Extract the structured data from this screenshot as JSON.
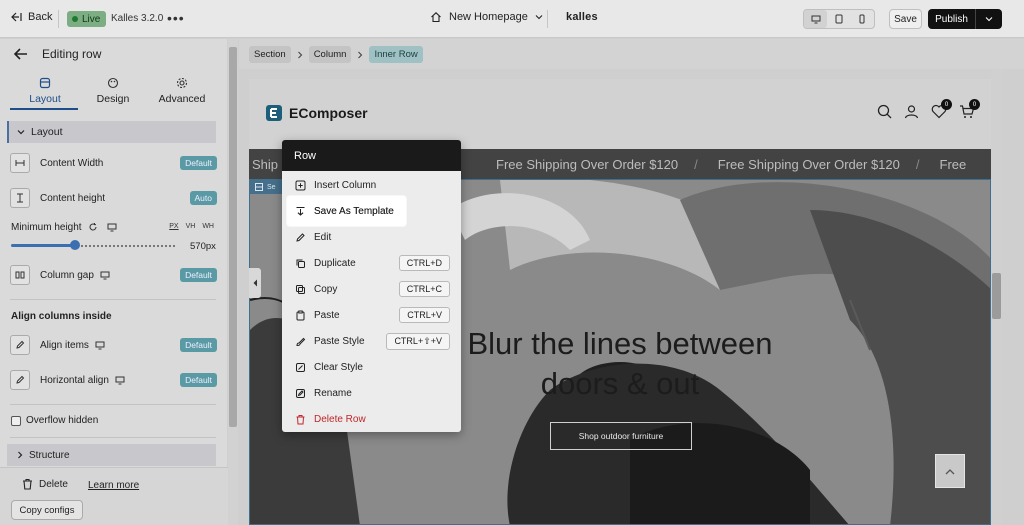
{
  "topbar": {
    "back_label": "Back",
    "live_label": "Live",
    "version": "Kalles 3.2.0",
    "page_name": "New Homepage",
    "brand": "kalles",
    "save_label": "Save",
    "publish_label": "Publish"
  },
  "panel": {
    "title": "Editing row",
    "tabs": [
      {
        "label": "Layout"
      },
      {
        "label": "Design"
      },
      {
        "label": "Advanced"
      }
    ],
    "layout_section": "Layout",
    "content_width": {
      "label": "Content Width",
      "badge": "Default"
    },
    "content_height": {
      "label": "Content height",
      "badge": "Auto"
    },
    "min_height": {
      "label": "Minimum height",
      "units": [
        "PX",
        "VH",
        "WH"
      ],
      "value": "570px",
      "slider_fraction": 0.39
    },
    "column_gap": {
      "label": "Column gap",
      "badge": "Default"
    },
    "align_heading": "Align columns inside",
    "align_items": {
      "label": "Align items",
      "badge": "Default"
    },
    "horizontal_align": {
      "label": "Horizontal align",
      "badge": "Default"
    },
    "overflow_label": "Overflow hidden",
    "structure_section": "Structure",
    "delete_label": "Delete",
    "learn_more": "Learn more",
    "copy_configs": "Copy configs"
  },
  "breadcrumb": [
    "Section",
    "Column",
    "Inner Row"
  ],
  "site": {
    "logo": "EComposer",
    "counts": {
      "wishlist": "0",
      "cart": "0"
    },
    "marquee_first": "Ship",
    "marquee_items": [
      "Free Shipping Over Order $120",
      "Free Shipping Over Order $120",
      "Free"
    ],
    "marquee_sep": "/",
    "hero_line1": "Blur the lines between",
    "hero_line2": "doors & out",
    "hero_button": "Shop outdoor furniture",
    "selection_label": "Se"
  },
  "context_menu": {
    "title": "Row",
    "items": [
      {
        "label": "Insert Column",
        "shortcut": ""
      },
      {
        "label": "Save As Template",
        "shortcut": ""
      },
      {
        "label": "Edit",
        "shortcut": ""
      },
      {
        "label": "Duplicate",
        "shortcut": "CTRL+D"
      },
      {
        "label": "Copy",
        "shortcut": "CTRL+C"
      },
      {
        "label": "Paste",
        "shortcut": "CTRL+V"
      },
      {
        "label": "Paste Style",
        "shortcut": "CTRL+⇧+V"
      },
      {
        "label": "Clear Style",
        "shortcut": ""
      },
      {
        "label": "Rename",
        "shortcut": ""
      },
      {
        "label": "Delete Row",
        "shortcut": ""
      }
    ]
  },
  "colors": {
    "accent": "#1e4e8a",
    "badge": "#5a9aa4",
    "danger": "#c0262a",
    "live": "#7dae83"
  }
}
